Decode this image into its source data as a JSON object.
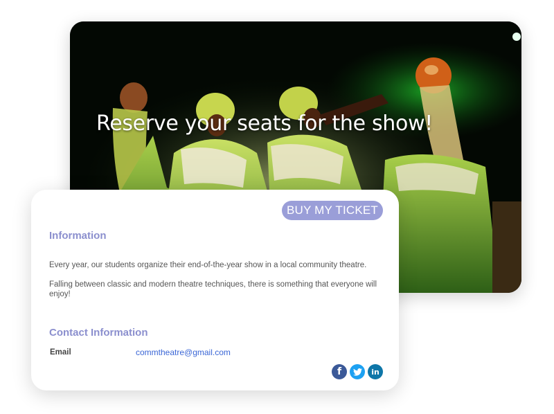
{
  "hero": {
    "title": "Reserve your seats for the show!"
  },
  "card": {
    "buy_button": "BUY MY TICKET",
    "info_title": "Information",
    "paragraph_1": "Every year, our students organize their end-of-the-year show in a local community theatre.",
    "paragraph_2": "Falling between classic and modern theatre techniques, there is something that everyone will enjoy!",
    "contact_title": "Contact Information",
    "email_label": "Email",
    "email_value": "commtheatre@gmail.com",
    "social": [
      {
        "icon": "facebook-icon",
        "glyph": "f",
        "color": "#3b5998"
      },
      {
        "icon": "twitter-icon",
        "color": "#1da1f2"
      },
      {
        "icon": "linkedin-icon",
        "glyph": "in",
        "color": "#0e76a8"
      }
    ]
  },
  "colors": {
    "accent": "#8b8fce",
    "button": "#9a9ed8",
    "link": "#3a66d6"
  }
}
